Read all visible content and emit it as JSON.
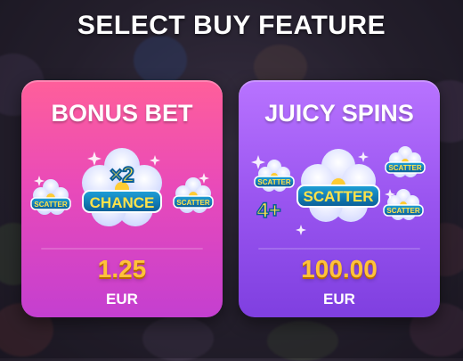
{
  "header": {
    "title": "SELECT BUY FEATURE"
  },
  "cards": [
    {
      "title": "BONUS BET",
      "price": "1.25",
      "currency": "EUR",
      "badges": {
        "left": "SCATTER",
        "multiplier": "×2",
        "center": "CHANCE",
        "right": "SCATTER"
      },
      "gradient": [
        "#ff5f9a",
        "#c43fd0"
      ]
    },
    {
      "title": "JUICY SPINS",
      "price": "100.00",
      "currency": "EUR",
      "badges": {
        "top_left": "SCATTER",
        "count": "4+",
        "center": "SCATTER",
        "top_right": "SCATTER",
        "bottom_right": "SCATTER"
      },
      "gradient": [
        "#b873ff",
        "#7f3fe0"
      ]
    }
  ],
  "colors": {
    "price": "#ffc23a",
    "badge": "#0d6ea8",
    "badge_text": "#ffe24a"
  },
  "icons": [
    "flower-icon",
    "sparkle-icon"
  ]
}
